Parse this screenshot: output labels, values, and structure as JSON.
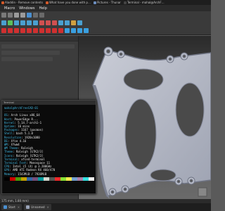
{
  "taskbar": {
    "items": [
      {
        "label": "Aladdin - Remove contents",
        "icon": "browser-icon",
        "color": "#d35a2a"
      },
      {
        "label": "What have you done with p…",
        "icon": "browser-icon",
        "color": "#d35a2a"
      },
      {
        "label": "Pictures - Thunar",
        "icon": "folder-icon",
        "color": "#6c8ebf"
      },
      {
        "label": "Terminal - mahal@ArchF…",
        "icon": "terminal-icon",
        "color": "#444444"
      }
    ]
  },
  "menubar": {
    "items": [
      "Macro",
      "Windows",
      "Help"
    ]
  },
  "terminal": {
    "title": "Terminal",
    "header": "mahal@ArchFreeCAD-01",
    "separator": "--------------------",
    "lines": [
      {
        "key": "OS",
        "val": "Arch Linux x86_64"
      },
      {
        "key": "Host",
        "val": "PowerEdge R..."
      },
      {
        "key": "Kernel",
        "val": "5.14.7-arch1-1"
      },
      {
        "key": "Uptime",
        "val": "16 mins"
      },
      {
        "key": "Packages",
        "val": "1167 (pacman)"
      },
      {
        "key": "Shell",
        "val": "bash 5.1.8"
      },
      {
        "key": "Resolution",
        "val": "1920x1080"
      },
      {
        "key": "DE",
        "val": "Xfce 4.16"
      },
      {
        "key": "WM",
        "val": "Xfwm4"
      },
      {
        "key": "WM Theme",
        "val": "Raleigh"
      },
      {
        "key": "Theme",
        "val": "Raleigh [GTK2/3]"
      },
      {
        "key": "Icons",
        "val": "Raleigh [GTK2/3]"
      },
      {
        "key": "Terminal",
        "val": "xfce4-terminal"
      },
      {
        "key": "Terminal Font",
        "val": "Monospace 11"
      },
      {
        "key": "CPU",
        "val": "Intel i5 (4) @ 3.200GHz"
      },
      {
        "key": "GPU",
        "val": "AMD ATI Radeon RX 460/470"
      },
      {
        "key": "Memory",
        "val": "1543MiB / 7936MiB"
      }
    ],
    "swatches": [
      "#000000",
      "#cc0000",
      "#4e9a06",
      "#c4a000",
      "#3465a4",
      "#75507b",
      "#06989a",
      "#d3d7cf",
      "#555753",
      "#ef2929",
      "#8ae234",
      "#fce94f",
      "#729fcf",
      "#ad7fa8",
      "#34e2e2",
      "#eeeeec"
    ]
  },
  "statusbar": {
    "text": "175 mm, 1.80 mm)"
  },
  "bottombar": {
    "tabs": [
      {
        "label": "Start",
        "icon": "start-icon"
      },
      {
        "label": "Unnamed",
        "icon": "document-icon"
      }
    ]
  },
  "colors": {
    "toolbar_icons_1": [
      "#7a7a7a",
      "#7a7a7a",
      "#9b9b9b",
      "#9b9b9b",
      "#4a8fd0",
      "#6a6a6a",
      "#6a6a6a"
    ],
    "toolbar_icons_2": [
      "#4aa0d0",
      "#5bbf5b",
      "#4aa0d0",
      "#4aa0d0",
      "#4aa0d0",
      "#4aa0d0",
      "#d05050",
      "#d05050",
      "#d05050",
      "#4aa0d0",
      "#4aa0d0",
      "#d0a040",
      "#4aa0d0"
    ],
    "toolbar_icons_3": [
      "#d03030",
      "#d03030",
      "#d03030",
      "#d03030",
      "#d03030",
      "#d03030",
      "#d03030",
      "#d03030",
      "#d03030",
      "#d03030",
      "#3aa0e0",
      "#3aa0e0",
      "#3aa0e0",
      "#3aa0e0"
    ]
  }
}
